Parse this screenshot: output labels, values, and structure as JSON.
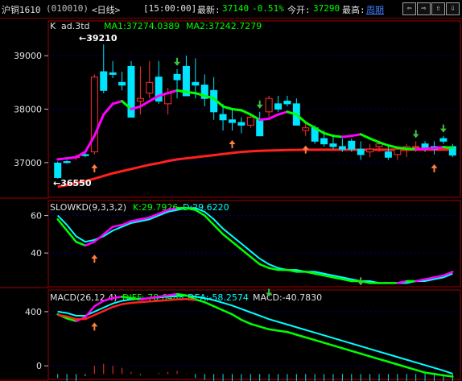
{
  "header": {
    "instrument": "沪铜1610",
    "code": "(010010)",
    "period": "<日线>",
    "time": "[15:00:00]",
    "latest_label": "最新:",
    "latest_value": "37140",
    "change": "-0.51%",
    "open_label": "今开:",
    "open_value": "37290",
    "high_label": "最高:",
    "cycle_label": "周期",
    "nav_buttons": [
      "⇦",
      "⇨",
      "⇧",
      "⇩"
    ]
  },
  "colors": {
    "up": "#ff3030",
    "down": "#00e5ff",
    "ma1": "#00ff00",
    "ma1_alt": "#ff00ff",
    "ma2": "#ff2020",
    "k_line": "#ff00ff",
    "d_line": "#00ffff",
    "panel_border": "#a00000",
    "grid": "#000080"
  },
  "chart_data": [
    {
      "type": "candlestick",
      "title": "K",
      "indicator_label": "ad.3td",
      "ma1_label": "MA1:37274.0389",
      "ma2_label": "MA2:37242.7279",
      "y_ticks": [
        37000,
        38000,
        39000
      ],
      "ylim": [
        36350,
        39650
      ],
      "high_annotation": "39210",
      "low_annotation": "36550",
      "candles": [
        [
          36990,
          37020,
          36700,
          36720
        ],
        [
          37020,
          37050,
          36980,
          37000
        ],
        [
          37100,
          37150,
          37050,
          37110
        ],
        [
          37150,
          37200,
          37100,
          37130
        ],
        [
          37200,
          38650,
          37150,
          38600
        ],
        [
          38700,
          39210,
          38300,
          38350
        ],
        [
          38680,
          38900,
          38580,
          38650
        ],
        [
          38500,
          38700,
          38350,
          38450
        ],
        [
          38800,
          38900,
          37950,
          37850
        ],
        [
          38150,
          38800,
          37900,
          38200
        ],
        [
          38300,
          38900,
          38200,
          38500
        ],
        [
          38600,
          38900,
          38100,
          38150
        ],
        [
          38100,
          38400,
          37900,
          38300
        ],
        [
          38650,
          38750,
          38200,
          38550
        ],
        [
          38800,
          39000,
          38350,
          38250
        ],
        [
          38500,
          38950,
          38200,
          38450
        ],
        [
          38450,
          38650,
          38050,
          38200
        ],
        [
          38350,
          38600,
          37800,
          37950
        ],
        [
          37900,
          38100,
          37600,
          37800
        ],
        [
          37800,
          38000,
          37600,
          37750
        ],
        [
          37750,
          37850,
          37550,
          37700
        ],
        [
          37700,
          37900,
          37650,
          37850
        ],
        [
          37800,
          37950,
          37600,
          37500
        ],
        [
          37950,
          38250,
          37850,
          38200
        ],
        [
          38100,
          38250,
          37950,
          38000
        ],
        [
          38150,
          38250,
          38050,
          38100
        ],
        [
          38100,
          38200,
          37700,
          37700
        ],
        [
          37600,
          37750,
          37500,
          37650
        ],
        [
          37650,
          37700,
          37350,
          37400
        ],
        [
          37450,
          37600,
          37300,
          37350
        ],
        [
          37350,
          37500,
          37250,
          37300
        ],
        [
          37300,
          37450,
          37200,
          37250
        ],
        [
          37400,
          37450,
          37200,
          37250
        ],
        [
          37250,
          37400,
          37050,
          37150
        ],
        [
          37200,
          37350,
          37100,
          37250
        ],
        [
          37300,
          37400,
          37200,
          37350
        ],
        [
          37200,
          37300,
          37050,
          37100
        ],
        [
          37150,
          37300,
          37050,
          37250
        ],
        [
          37250,
          37350,
          37100,
          37300
        ],
        [
          37300,
          37400,
          37200,
          37300
        ],
        [
          37350,
          37400,
          37200,
          37250
        ],
        [
          37300,
          37400,
          37150,
          37250
        ],
        [
          37450,
          37500,
          37350,
          37400
        ],
        [
          37300,
          37350,
          37100,
          37140
        ]
      ],
      "ma1": [
        37060,
        37080,
        37100,
        37200,
        37500,
        37900,
        38100,
        38150,
        38000,
        38050,
        38150,
        38250,
        38300,
        38350,
        38320,
        38300,
        38250,
        38200,
        38050,
        38000,
        37980,
        37900,
        37800,
        37820,
        37900,
        37950,
        37900,
        37750,
        37650,
        37550,
        37500,
        37480,
        37500,
        37530,
        37450,
        37380,
        37320,
        37280,
        37260,
        37250,
        37260,
        37270,
        37290,
        37274
      ],
      "ma2": [
        36550,
        36580,
        36620,
        36650,
        36700,
        36750,
        36800,
        36840,
        36880,
        36920,
        36960,
        36990,
        37030,
        37060,
        37080,
        37100,
        37120,
        37140,
        37160,
        37180,
        37200,
        37210,
        37220,
        37225,
        37230,
        37235,
        37238,
        37240,
        37240,
        37240,
        37240,
        37240,
        37240,
        37240,
        37240,
        37240,
        37240,
        37240,
        37240,
        37242,
        37242,
        37242,
        37242,
        37242
      ]
    },
    {
      "type": "line",
      "title": "SLOWKD(9,3,3,2)",
      "k_label": "K:29.7926",
      "d_label": "D:29.6220",
      "y_ticks": [
        40,
        60
      ],
      "ylim": [
        22,
        68
      ],
      "series": [
        {
          "name": "K",
          "values": [
            58,
            52,
            46,
            44,
            46,
            50,
            54,
            55,
            57,
            58,
            59,
            61,
            63,
            64,
            64,
            63,
            60,
            55,
            50,
            46,
            42,
            38,
            34,
            32,
            31,
            31,
            30,
            30,
            29,
            28,
            27,
            26,
            25,
            25,
            24,
            24,
            24,
            24,
            25,
            25,
            26,
            27,
            28,
            30
          ]
        },
        {
          "name": "D",
          "values": [
            60,
            55,
            49,
            46,
            47,
            49,
            52,
            54,
            56,
            57,
            58,
            60,
            62,
            63,
            64,
            64,
            62,
            58,
            53,
            49,
            45,
            41,
            37,
            34,
            32,
            31,
            31,
            30,
            30,
            29,
            28,
            27,
            26,
            25,
            25,
            24,
            24,
            24,
            24,
            25,
            25,
            26,
            27,
            29
          ]
        }
      ]
    },
    {
      "type": "bar",
      "title": "MACD(26,12,4)",
      "diff_label": "DIFF:-78.6488",
      "dea_label": "DEA:-58.2574",
      "macd_label": "MACD:-40.7830",
      "y_ticks": [
        0,
        400
      ],
      "ylim": [
        -100,
        560
      ],
      "series": [
        {
          "name": "DIFF",
          "values": [
            380,
            350,
            330,
            360,
            440,
            480,
            500,
            510,
            500,
            490,
            500,
            510,
            520,
            530,
            520,
            490,
            470,
            440,
            410,
            380,
            340,
            310,
            290,
            270,
            260,
            250,
            230,
            210,
            190,
            170,
            150,
            130,
            110,
            90,
            70,
            50,
            30,
            10,
            -10,
            -30,
            -50,
            -60,
            -70,
            -79
          ]
        },
        {
          "name": "DEA",
          "values": [
            400,
            390,
            370,
            370,
            400,
            430,
            460,
            480,
            490,
            495,
            500,
            505,
            510,
            515,
            518,
            510,
            500,
            485,
            465,
            445,
            420,
            395,
            370,
            345,
            325,
            305,
            285,
            265,
            245,
            225,
            205,
            185,
            165,
            145,
            125,
            105,
            85,
            65,
            45,
            25,
            5,
            -15,
            -35,
            -58
          ]
        },
        {
          "name": "MACD",
          "values": [
            -20,
            -40,
            -40,
            -10,
            40,
            50,
            40,
            30,
            10,
            -5,
            0,
            5,
            10,
            15,
            2,
            -20,
            -30,
            -45,
            -55,
            -65,
            -80,
            -85,
            -80,
            -75,
            -65,
            -55,
            -55,
            -55,
            -55,
            -55,
            -55,
            -55,
            -55,
            -55,
            -55,
            -55,
            -55,
            -55,
            -55,
            -55,
            -55,
            -45,
            -35,
            -41
          ]
        }
      ]
    }
  ]
}
